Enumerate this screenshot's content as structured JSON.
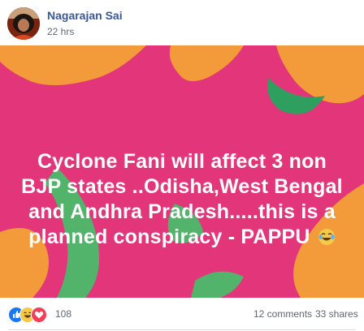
{
  "post": {
    "author": "Nagarajan Sai",
    "time": "22 hrs",
    "message": "Cyclone Fani will affect 3 non BJP states ..Odisha,West Bengal and Andhra Pradesh.....this is a planned conspiracy - PAPPU",
    "message_emoji": "laughing-tears-emoji",
    "background": {
      "base_color": "#e3357a",
      "accent_orange": "#f39a3a",
      "accent_green": "#52b36b"
    }
  },
  "footer": {
    "reaction_icons": [
      "like-icon",
      "haha-icon",
      "love-icon"
    ],
    "reaction_count": "108",
    "comments": "12 comments",
    "shares": "33 shares"
  }
}
